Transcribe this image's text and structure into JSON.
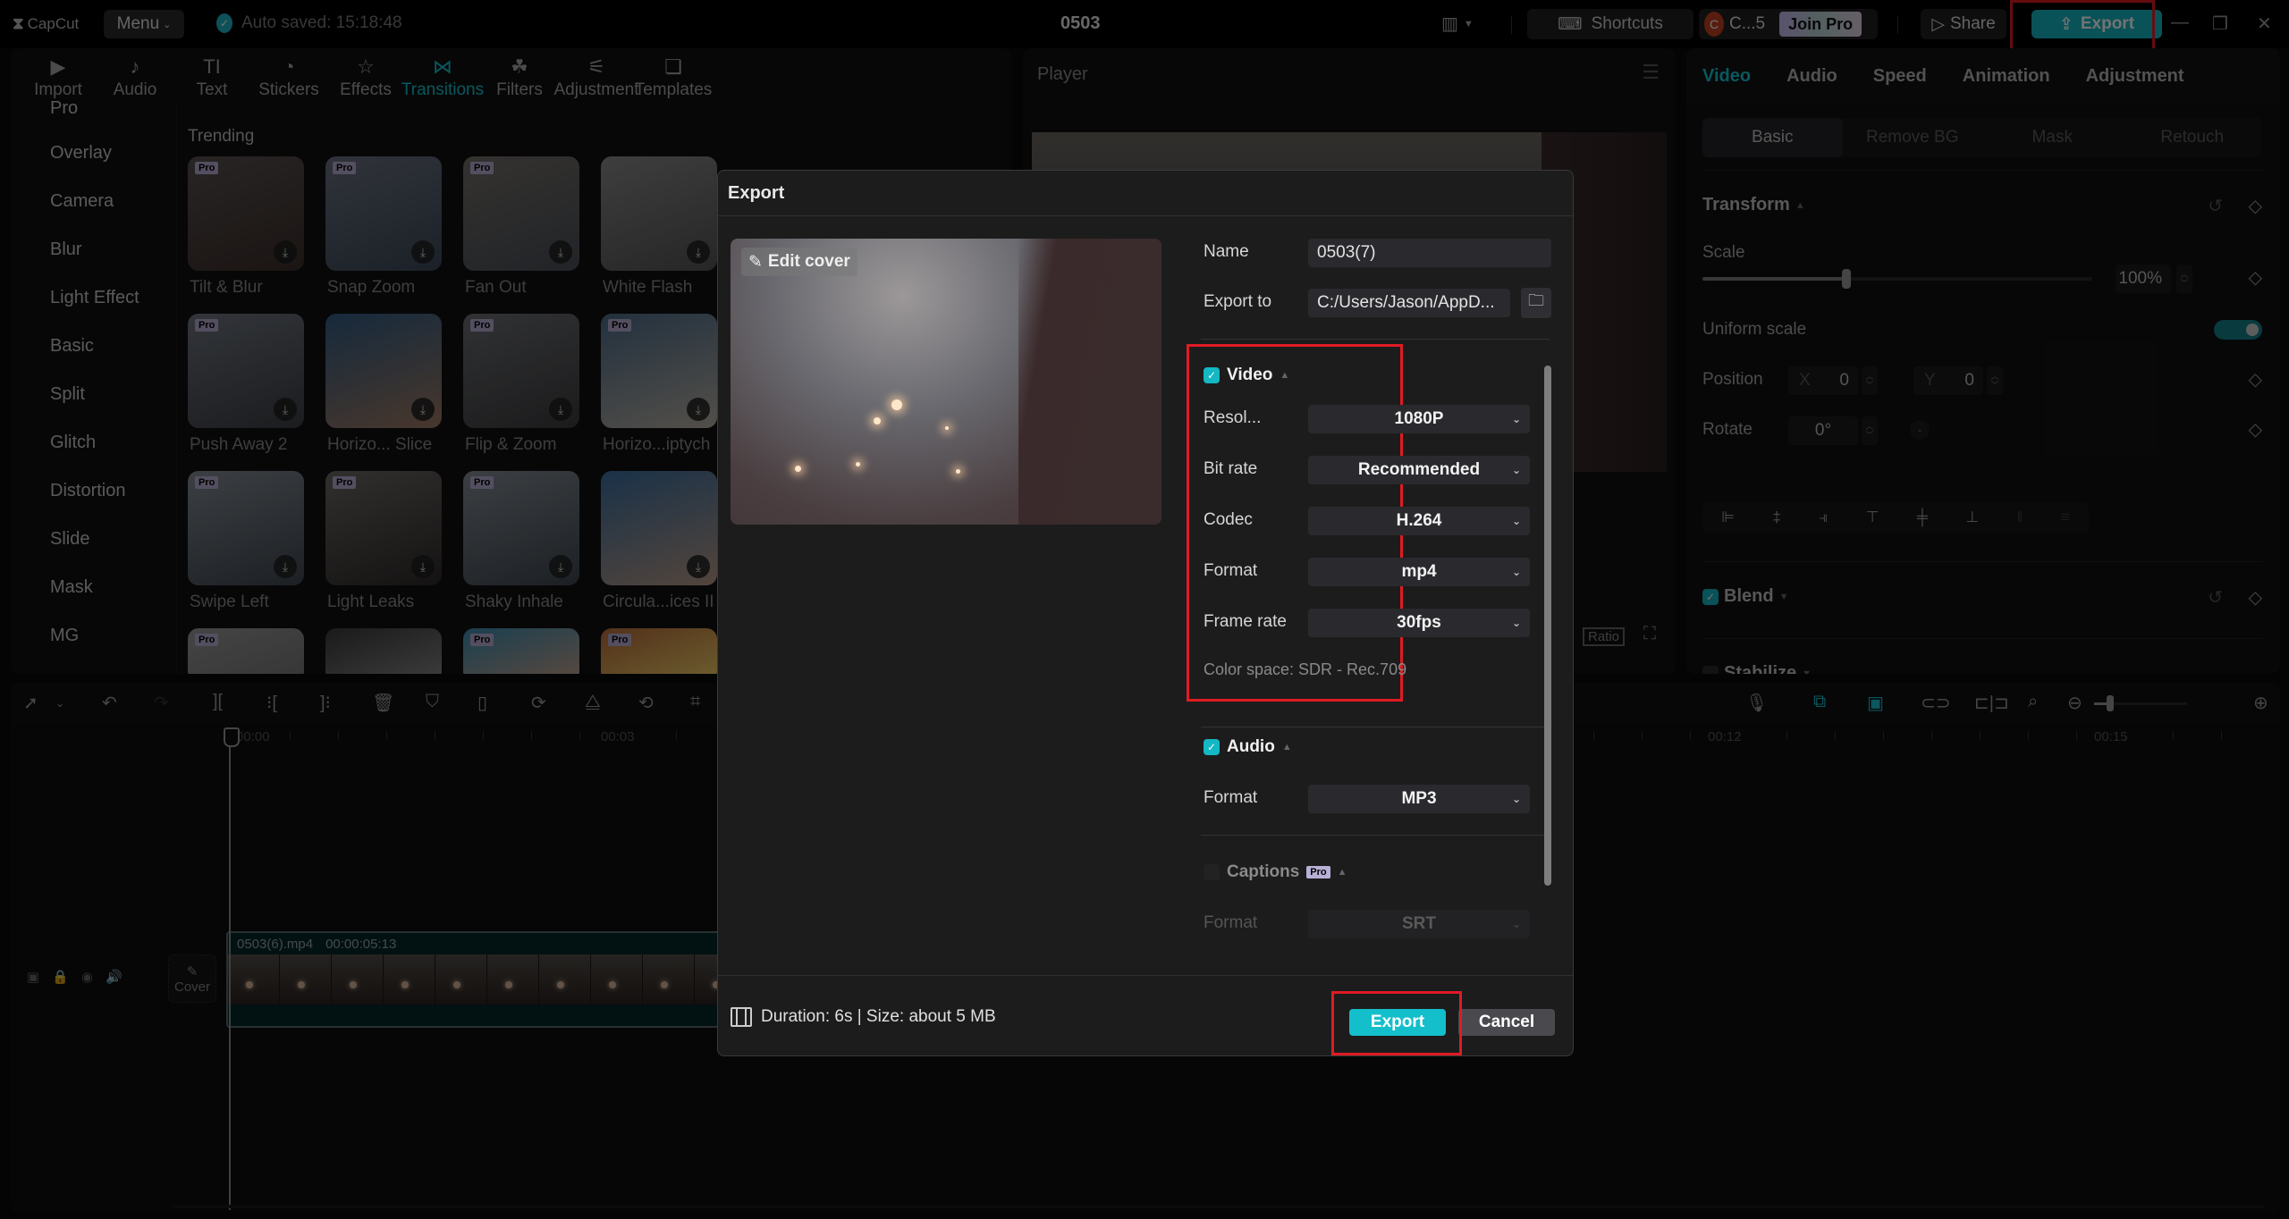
{
  "app": {
    "logo": "CapCut",
    "menu_label": "Menu",
    "autosave": "Auto saved: 15:18:48",
    "project_title": "0503",
    "shortcuts_label": "Shortcuts",
    "user_initial": "C",
    "user_name": "C...5",
    "join_pro_label": "Join Pro",
    "share_label": "Share",
    "export_label": "Export",
    "accent_color": "#14b7c4"
  },
  "media_tabs": [
    {
      "label": "Import",
      "icon": "import-icon"
    },
    {
      "label": "Audio",
      "icon": "audio-icon"
    },
    {
      "label": "Text",
      "icon": "text-icon"
    },
    {
      "label": "Stickers",
      "icon": "stickers-icon"
    },
    {
      "label": "Effects",
      "icon": "effects-icon"
    },
    {
      "label": "Transitions",
      "icon": "transitions-icon",
      "active": true
    },
    {
      "label": "Filters",
      "icon": "filters-icon"
    },
    {
      "label": "Adjustment",
      "icon": "adjustment-icon"
    },
    {
      "label": "Templates",
      "icon": "templates-icon"
    }
  ],
  "categories": [
    "Pro",
    "Overlay",
    "Camera",
    "Blur",
    "Light Effect",
    "Basic",
    "Split",
    "Glitch",
    "Distortion",
    "Slide",
    "Mask",
    "MG"
  ],
  "trending": {
    "title": "Trending",
    "items": [
      {
        "name": "Tilt & Blur",
        "pro": true
      },
      {
        "name": "Snap Zoom",
        "pro": true
      },
      {
        "name": "Fan Out",
        "pro": true
      },
      {
        "name": "White Flash",
        "pro": false
      },
      {
        "name": "Push Away 2",
        "pro": true
      },
      {
        "name": "Horizo... Slice",
        "pro": false
      },
      {
        "name": "Flip & Zoom",
        "pro": true
      },
      {
        "name": "Horizo...iptych",
        "pro": true
      },
      {
        "name": "Swipe Left",
        "pro": true
      },
      {
        "name": "Light Leaks",
        "pro": true
      },
      {
        "name": "Shaky Inhale",
        "pro": true
      },
      {
        "name": "Circula...ices II",
        "pro": false
      },
      {
        "name": "",
        "pro": true
      },
      {
        "name": "",
        "pro": false
      },
      {
        "name": "",
        "pro": true
      },
      {
        "name": "",
        "pro": true
      }
    ],
    "pro_tag": "Pro"
  },
  "player": {
    "title": "Player",
    "ratio_label": "Ratio"
  },
  "properties": {
    "tabs": [
      "Video",
      "Audio",
      "Speed",
      "Animation",
      "Adjustment"
    ],
    "active_tab": "Video",
    "sub_tabs": [
      "Basic",
      "Remove BG",
      "Mask",
      "Retouch"
    ],
    "active_sub_tab": "Basic",
    "transform_title": "Transform",
    "scale_label": "Scale",
    "scale_value": "100%",
    "scale_slider_fraction": 0.37,
    "uniform_scale_label": "Uniform scale",
    "uniform_scale_on": true,
    "position_label": "Position",
    "position_x_label": "X",
    "position_x": "0",
    "position_y_label": "Y",
    "position_y": "0",
    "rotate_label": "Rotate",
    "rotate_value": "0°",
    "blend_label": "Blend",
    "blend_checked": true,
    "stabilize_label": "Stabilize",
    "stabilize_checked": false
  },
  "timeline": {
    "ruler": [
      "00:00",
      "00:03",
      "00:12",
      "00:15"
    ],
    "clip_name": "0503(6).mp4",
    "clip_duration": "00:00:05:13",
    "cover_label": "Cover"
  },
  "export_dialog": {
    "title": "Export",
    "edit_cover_label": "Edit cover",
    "name_label": "Name",
    "name_value": "0503(7)",
    "export_to_label": "Export to",
    "export_to_value": "C:/Users/Jason/AppD...",
    "video": {
      "label": "Video",
      "checked": true,
      "resolution_label": "Resol...",
      "resolution": "1080P",
      "bitrate_label": "Bit rate",
      "bitrate": "Recommended",
      "codec_label": "Codec",
      "codec": "H.264",
      "format_label": "Format",
      "format": "mp4",
      "framerate_label": "Frame rate",
      "framerate": "30fps",
      "color_space": "Color space: SDR - Rec.709"
    },
    "audio": {
      "label": "Audio",
      "checked": true,
      "format_label": "Format",
      "format": "MP3"
    },
    "captions": {
      "label": "Captions",
      "checked": false,
      "pro_tag": "Pro",
      "format_label": "Format",
      "format": "SRT"
    },
    "footer_info": "Duration: 6s | Size: about 5 MB",
    "export_label": "Export",
    "cancel_label": "Cancel"
  }
}
